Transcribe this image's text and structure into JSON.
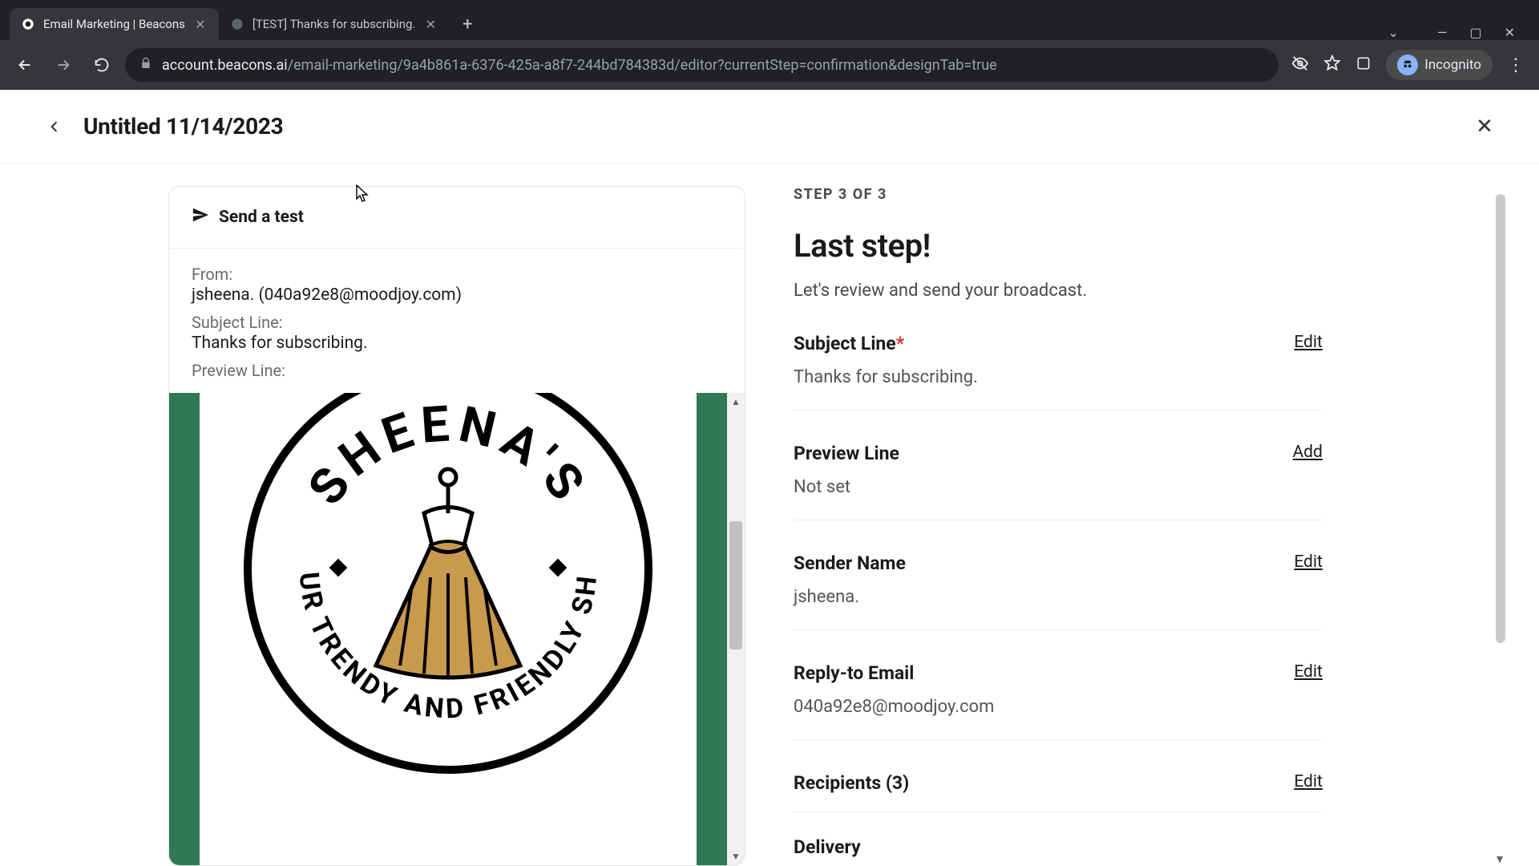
{
  "browser": {
    "tabs": [
      {
        "title": "Email Marketing | Beacons",
        "active": true
      },
      {
        "title": "[TEST] Thanks for subscribing.",
        "active": false
      }
    ],
    "url_host": "account.beacons.ai",
    "url_path": "/email-marketing/9a4b861a-6376-425a-a8f7-244bd784383d/editor?currentStep=confirmation&designTab=true",
    "incognito_label": "Incognito"
  },
  "header": {
    "title": "Untitled 11/14/2023"
  },
  "preview": {
    "send_test_label": "Send a test",
    "from_label": "From:",
    "from_value": "jsheena. (040a92e8@moodjoy.com)",
    "subject_label": "Subject Line:",
    "subject_value": "Thanks for subscribing.",
    "preview_label": "Preview Line:",
    "logo_top_text": "SHEENA'S",
    "logo_bottom_text": "YOUR TRENDY AND FRIENDLY SHOP"
  },
  "panel": {
    "step": "STEP 3 OF 3",
    "headline": "Last step!",
    "subtext": "Let's review and send your broadcast.",
    "fields": {
      "subject": {
        "label": "Subject Line",
        "required": "*",
        "action": "Edit",
        "value": "Thanks for subscribing."
      },
      "preview": {
        "label": "Preview Line",
        "action": "Add",
        "value": "Not set"
      },
      "sender": {
        "label": "Sender Name",
        "action": "Edit",
        "value": "jsheena."
      },
      "reply": {
        "label": "Reply-to Email",
        "action": "Edit",
        "value": "040a92e8@moodjoy.com"
      },
      "recipients": {
        "label": "Recipients (3)",
        "action": "Edit"
      },
      "delivery": {
        "label": "Delivery"
      }
    }
  }
}
